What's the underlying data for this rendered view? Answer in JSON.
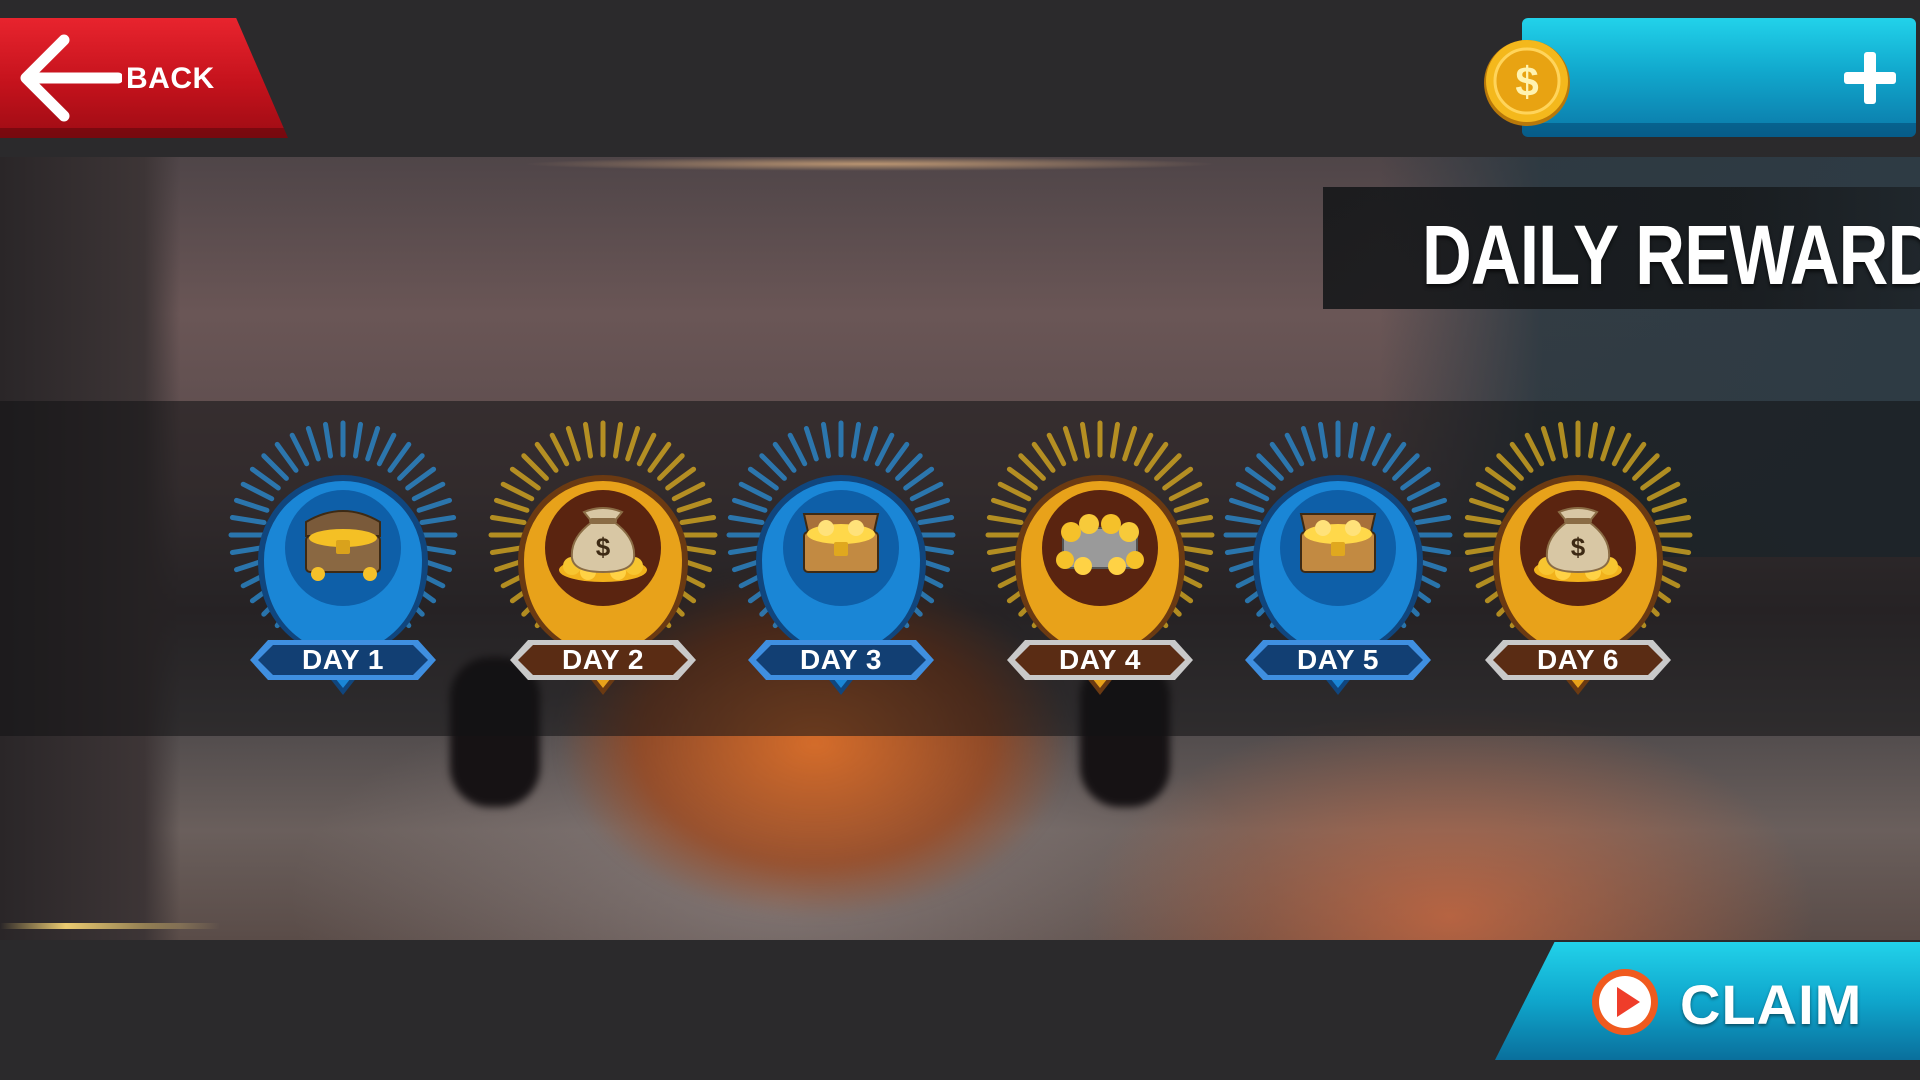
{
  "back_button": {
    "label": "BACK",
    "icon": "arrow-left-icon"
  },
  "currency": {
    "icon": "coin-icon",
    "symbol": "$",
    "add_icon": "plus-icon"
  },
  "title": "DAILY REWARD",
  "rewards": [
    {
      "day": "DAY 1",
      "theme": "blue",
      "icon": "treasure-chest-icon"
    },
    {
      "day": "DAY 2",
      "theme": "gold",
      "icon": "money-bag-icon"
    },
    {
      "day": "DAY 3",
      "theme": "blue",
      "icon": "open-treasure-chest-icon"
    },
    {
      "day": "DAY 4",
      "theme": "gold",
      "icon": "coin-piles-icon"
    },
    {
      "day": "DAY 5",
      "theme": "blue",
      "icon": "open-treasure-chest-icon"
    },
    {
      "day": "DAY 6",
      "theme": "gold",
      "icon": "money-bag-icon"
    }
  ],
  "claim_button": {
    "label": "CLAIM",
    "icon": "play-video-icon"
  },
  "colors": {
    "blue": "#1a86d6",
    "blue_dark": "#10467e",
    "gold": "#e8a21a",
    "gold_dark": "#6b3a12",
    "back_red": "#d01820",
    "cyan": "#18b8dc"
  }
}
